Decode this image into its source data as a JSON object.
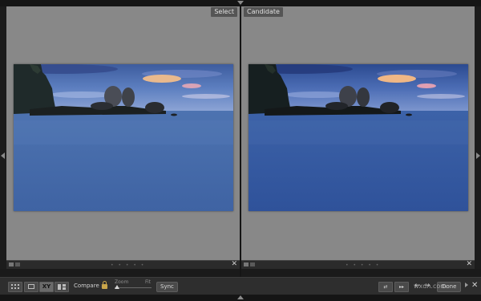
{
  "panes": {
    "select": {
      "label": "Select"
    },
    "candidate": {
      "label": "Candidate"
    }
  },
  "toolbar": {
    "compare_label": "Compare :",
    "zoom_label": "Zoom",
    "fit_label": "Fit",
    "sync_label": "Sync",
    "xy_label": "XY",
    "done_label": "Done"
  },
  "watermark": "wxdn.com",
  "colors": {
    "panel_gray": "#888888",
    "chrome_dark": "#2e2e2e",
    "lock_gold": "#c9a54a"
  },
  "icons": [
    "grid-view-icon",
    "loupe-view-icon",
    "compare-view-icon",
    "survey-view-icon",
    "lock-icon",
    "swap-icon",
    "make-select-icon",
    "arrow-left-icon",
    "arrow-right-icon"
  ]
}
